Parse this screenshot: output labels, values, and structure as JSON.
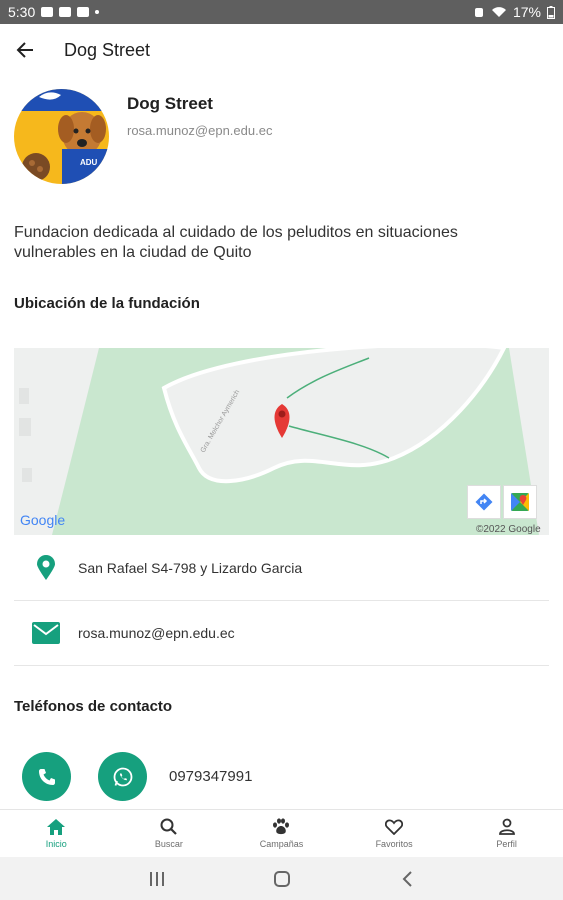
{
  "status_bar": {
    "time": "5:30",
    "battery": "17%"
  },
  "app_bar": {
    "title": "Dog Street"
  },
  "profile": {
    "name": "Dog Street",
    "email": "rosa.munoz@epn.edu.ec",
    "avatar_text": "ADU"
  },
  "description": "Fundacion dedicada al cuidado de los peluditos en situaciones vulnerables en la ciudad de Quito",
  "location_section": {
    "title": "Ubicación de la fundación",
    "map": {
      "street_label": "Gra. Melchor Aymerich",
      "logo": "Google",
      "copyright": "©2022 Google"
    }
  },
  "contact": {
    "address": "San Rafael S4-798 y Lizardo Garcia",
    "email": "rosa.munoz@epn.edu.ec"
  },
  "phones_section": {
    "title": "Teléfonos de contacto",
    "number": "0979347991"
  },
  "bottom_nav": {
    "items": [
      {
        "label": "Inicio",
        "icon": "home-icon",
        "active": true
      },
      {
        "label": "Buscar",
        "icon": "search-icon",
        "active": false
      },
      {
        "label": "Campañas",
        "icon": "paw-icon",
        "active": false
      },
      {
        "label": "Favoritos",
        "icon": "heart-icon",
        "active": false
      },
      {
        "label": "Perfil",
        "icon": "person-icon",
        "active": false
      }
    ]
  },
  "colors": {
    "accent": "#16a07e",
    "status_bar": "#5f5f5f",
    "map_green": "#c9e7cf",
    "map_pin": "#e53935"
  }
}
